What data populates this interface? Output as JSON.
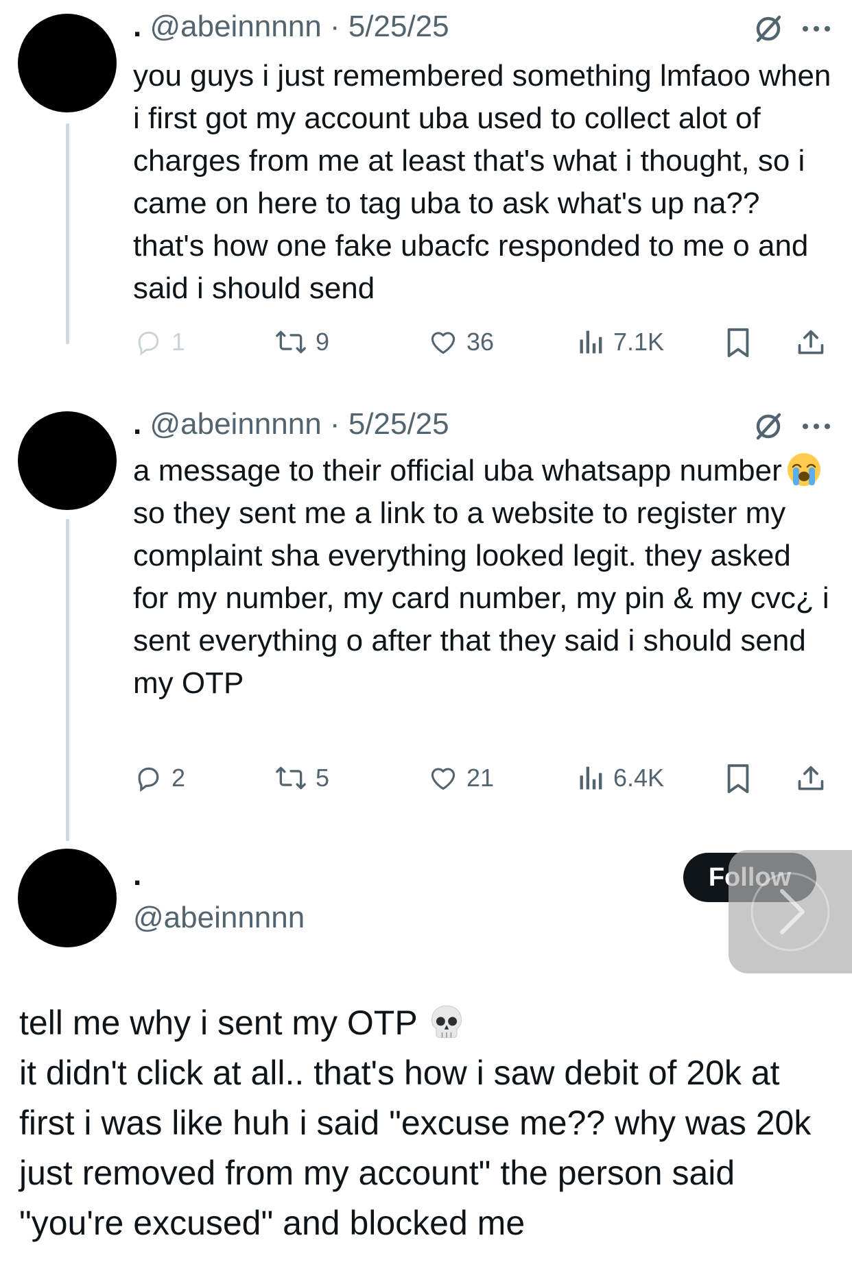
{
  "tweets": [
    {
      "display_name": ".",
      "handle": "@abeinnnnn",
      "separator": "·",
      "date": "5/25/25",
      "text": "you guys i just remembered something lmfaoo when i first got my account uba used to collect alot of charges from me at least that's what i thought, so i came on here to tag uba to ask what's up na?? that's how one fake ubacfc responded to me o and said i should send",
      "replies": "1",
      "retweets": "9",
      "likes": "36",
      "views": "7.1K"
    },
    {
      "display_name": ".",
      "handle": "@abeinnnnn",
      "separator": "·",
      "date": "5/25/25",
      "text_before_emoji": "a message to their official uba whatsapp number",
      "emoji": "loudly-crying-face",
      "text_after_emoji": "so they sent me a link to a website to register my complaint sha everything looked legit. they asked for my number, my card number, my pin & my cvc¿ i sent everything o after that they said i should send my OTP",
      "replies": "2",
      "retweets": "5",
      "likes": "21",
      "views": "6.4K"
    }
  ],
  "main": {
    "display_name": ".",
    "handle": "@abeinnnnn",
    "follow_label": "Follow",
    "text_line1": "tell me why i sent my OTP",
    "text_line1_emoji": "skull",
    "text_rest": "it didn't click at all.. that's how i saw debit of 20k at first i was like huh i said \"excuse me?? why was 20k just removed from my account\" the person said \"you're excused\" and blocked me"
  },
  "icons": {
    "reply": "reply-icon",
    "retweet": "retweet-icon",
    "like": "heart-icon",
    "views": "views-icon",
    "bookmark": "bookmark-icon",
    "share": "share-icon",
    "grok": "grok-icon",
    "more": "more-icon",
    "next": "chevron-right-icon"
  },
  "colors": {
    "text": "#0f1419",
    "secondary": "#536471",
    "thread_line": "#cfd9de",
    "follow_bg": "#0f1419"
  }
}
